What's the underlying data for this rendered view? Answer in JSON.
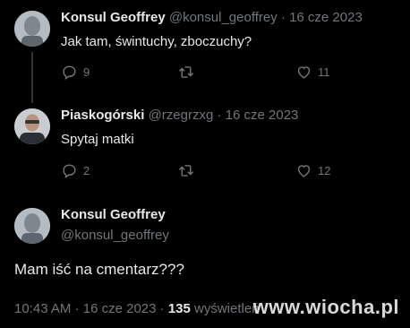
{
  "tweets": [
    {
      "name": "Konsul Geoffrey",
      "handle": "@konsul_geoffrey",
      "separator": "·",
      "date": "16 cze 2023",
      "text": "Jak tam, świntuchy, zboczuchy?",
      "replies": "9",
      "likes": "11"
    },
    {
      "name": "Piaskogórski",
      "handle": "@rzegrzxg",
      "separator": "·",
      "date": "16 cze 2023",
      "text": "Spytaj matki",
      "replies": "2",
      "likes": "12"
    }
  ],
  "focus": {
    "name": "Konsul Geoffrey",
    "handle": "@konsul_geoffrey",
    "text": "Mam iść na cmentarz???",
    "time": "10:43 AM",
    "separator1": "·",
    "date": "16 cze 2023",
    "separator2": "·",
    "views": "135",
    "views_label": "wyświetleń"
  },
  "watermark": "www.wiocha.pl",
  "icons": {
    "reply": "reply-icon",
    "retweet": "retweet-icon",
    "like": "heart-icon"
  }
}
